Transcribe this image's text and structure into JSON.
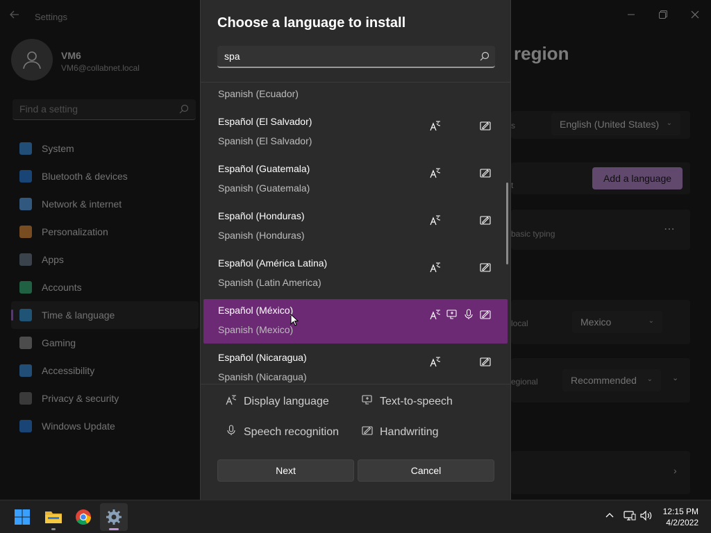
{
  "settings": {
    "app_title": "Settings",
    "profile": {
      "name": "VM6",
      "email": "VM6@collabnet.local"
    },
    "search_placeholder": "Find a setting",
    "nav": [
      {
        "label": "System",
        "icon": "system-icon",
        "color": "#3b8fd9"
      },
      {
        "label": "Bluetooth & devices",
        "icon": "bluetooth-icon",
        "color": "#2f7ed8"
      },
      {
        "label": "Network & internet",
        "icon": "network-icon",
        "color": "#5aa0e6"
      },
      {
        "label": "Personalization",
        "icon": "brush-icon",
        "color": "#d98a3b"
      },
      {
        "label": "Apps",
        "icon": "apps-icon",
        "color": "#6b7a8a"
      },
      {
        "label": "Accounts",
        "icon": "accounts-icon",
        "color": "#3bb07a"
      },
      {
        "label": "Time & language",
        "icon": "time-language-icon",
        "color": "#3b9ad9",
        "active": true
      },
      {
        "label": "Gaming",
        "icon": "gaming-icon",
        "color": "#8a8a8a"
      },
      {
        "label": "Accessibility",
        "icon": "accessibility-icon",
        "color": "#3b8fd9"
      },
      {
        "label": "Privacy & security",
        "icon": "shield-icon",
        "color": "#6b6b6b"
      },
      {
        "label": "Windows Update",
        "icon": "update-icon",
        "color": "#2f7ed8"
      }
    ],
    "page_heading_partial": "region",
    "display_language_value": "English (United States)",
    "add_language_label": "Add a language",
    "partial_text_s": "s",
    "partial_text_t": "t",
    "partial_basic_typing": "basic typing",
    "partial_local": "local",
    "country_value": "Mexico",
    "partial_regional": "egional",
    "regional_format_value": "Recommended"
  },
  "dialog": {
    "title": "Choose a language to install",
    "search_value": "spa",
    "languages": [
      {
        "name": "",
        "sub": "Spanish (Ecuador)",
        "features": []
      },
      {
        "name": "Español (El Salvador)",
        "sub": "Spanish (El Salvador)",
        "features": [
          "display",
          "handwriting"
        ]
      },
      {
        "name": "Español (Guatemala)",
        "sub": "Spanish (Guatemala)",
        "features": [
          "display",
          "handwriting"
        ]
      },
      {
        "name": "Español (Honduras)",
        "sub": "Spanish (Honduras)",
        "features": [
          "display",
          "handwriting"
        ]
      },
      {
        "name": "Español (América Latina)",
        "sub": "Spanish (Latin America)",
        "features": [
          "display",
          "handwriting"
        ]
      },
      {
        "name": "Español (México)",
        "sub": "Spanish (Mexico)",
        "features": [
          "display",
          "tts",
          "speech",
          "handwriting"
        ],
        "selected": true
      },
      {
        "name": "Español (Nicaragua)",
        "sub": "Spanish (Nicaragua)",
        "features": [
          "display",
          "handwriting"
        ]
      }
    ],
    "legend": {
      "display_language": "Display language",
      "text_to_speech": "Text-to-speech",
      "speech_recognition": "Speech recognition",
      "handwriting": "Handwriting"
    },
    "next_label": "Next",
    "cancel_label": "Cancel"
  },
  "taskbar": {
    "time": "12:15 PM",
    "date": "4/2/2022",
    "accent": "#c093d9"
  }
}
